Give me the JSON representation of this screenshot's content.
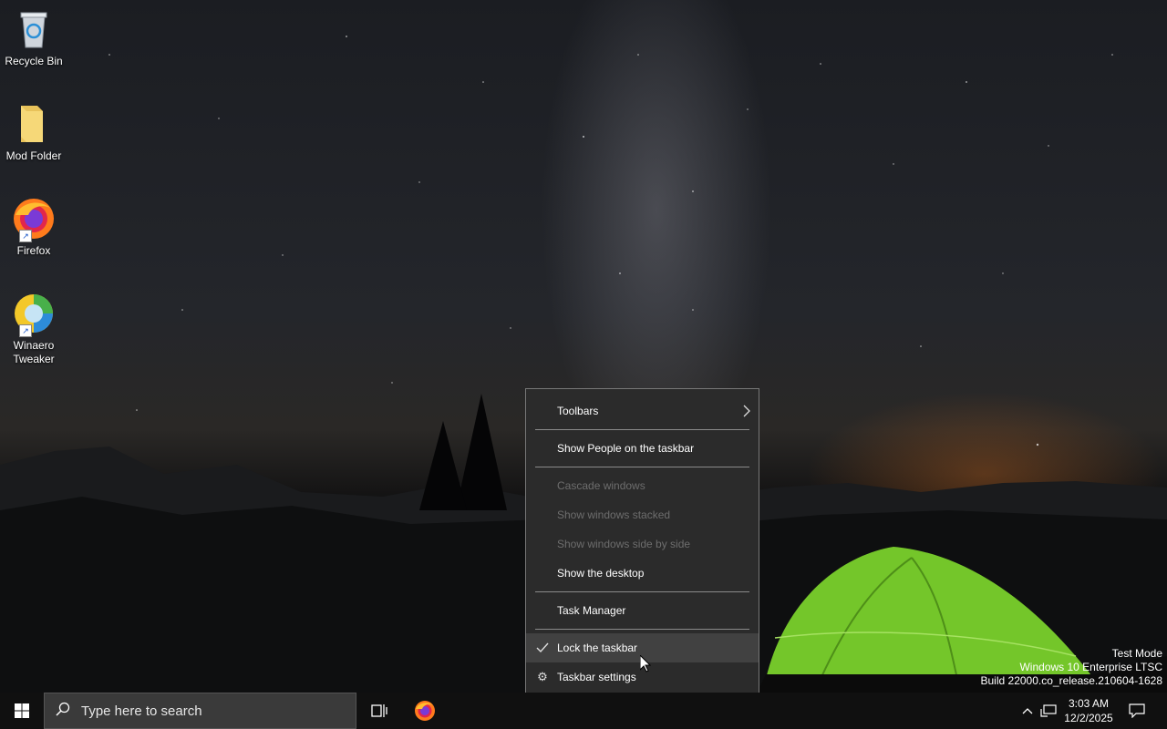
{
  "desktop": {
    "icons": [
      {
        "label": "Recycle Bin",
        "icon": "recycle-bin-icon"
      },
      {
        "label": "Mod Folder",
        "icon": "folder-icon"
      },
      {
        "label": "Firefox",
        "icon": "firefox-icon"
      },
      {
        "label": "Winaero Tweaker",
        "icon": "winaero-tweaker-icon"
      }
    ]
  },
  "context_menu": {
    "items": [
      {
        "label": "Toolbars",
        "submenu": true,
        "enabled": true
      },
      {
        "label": "Show People on the taskbar",
        "enabled": true
      },
      {
        "label": "Cascade windows",
        "enabled": false
      },
      {
        "label": "Show windows stacked",
        "enabled": false
      },
      {
        "label": "Show windows side by side",
        "enabled": false
      },
      {
        "label": "Show the desktop",
        "enabled": true
      },
      {
        "label": "Task Manager",
        "enabled": true
      },
      {
        "label": "Lock the taskbar",
        "checked": true,
        "hovered": true,
        "enabled": true
      },
      {
        "label": "Taskbar settings",
        "icon": "gear-icon",
        "enabled": true
      }
    ]
  },
  "watermark": {
    "line1": "Test Mode",
    "line2": "Windows 10 Enterprise LTSC",
    "line3": "Build 22000.co_release.210604-1628"
  },
  "taskbar": {
    "search_placeholder": "Type here to search",
    "clock_time": "3:03 AM",
    "clock_date": "12/2/2025",
    "pinned": [
      "task-view-icon",
      "firefox-icon"
    ],
    "tray": [
      "chevron-up-icon",
      "network-icon",
      "notification-icon"
    ]
  },
  "colors": {
    "taskbar_bg": "#101010",
    "menu_bg": "#2b2b2b",
    "menu_hover": "#414141",
    "menu_disabled_text": "#6d6d6d",
    "tent_green": "#7ccd2a"
  }
}
